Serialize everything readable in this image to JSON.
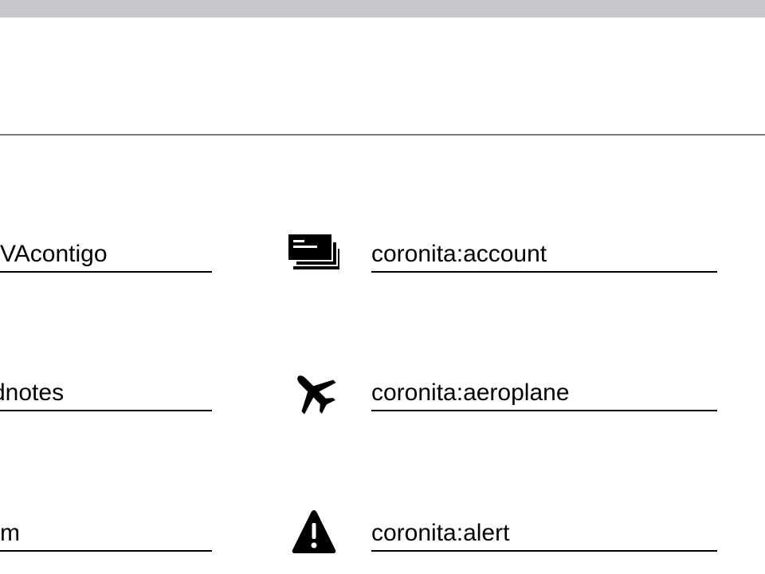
{
  "rows": [
    {
      "left_label": "VAcontigo",
      "icon": "account-icon",
      "right_label": "coronita:account"
    },
    {
      "left_label": "dnotes",
      "icon": "aeroplane-icon",
      "right_label": "coronita:aeroplane"
    },
    {
      "left_label": "rm",
      "icon": "alert-icon",
      "right_label": "coronita:alert"
    }
  ],
  "colors": {
    "topbar": "#c8c8cc",
    "divider": "#7a7a7a",
    "text": "#000000",
    "background": "#ffffff"
  }
}
